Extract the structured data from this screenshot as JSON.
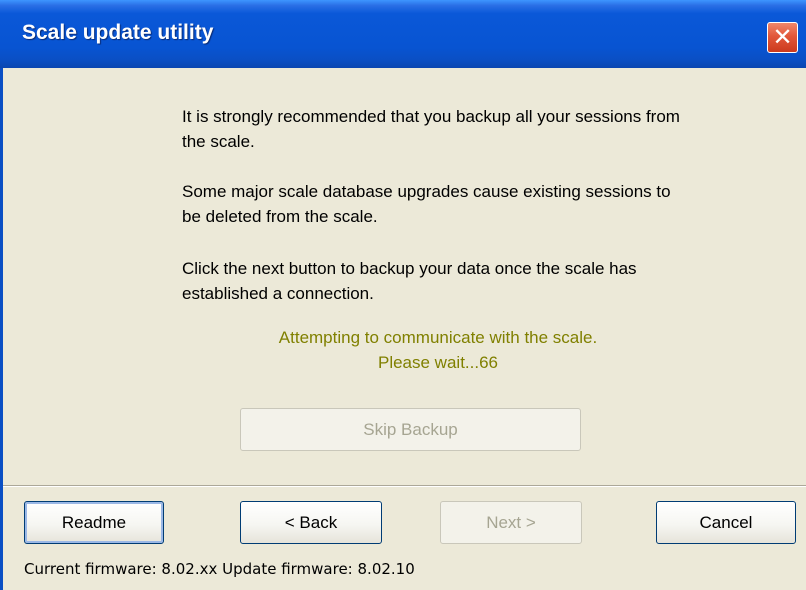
{
  "window": {
    "title": "Scale update utility",
    "close_symbol": "✕"
  },
  "content": {
    "para1": "It is strongly recommended that you backup all your sessions from the scale.",
    "para2": "Some major scale database upgrades cause existing sessions to be deleted from the scale.",
    "para3": "Click the next button to backup your data once the scale has established a connection.",
    "status_line1": "Attempting to communicate with the scale.",
    "status_line2": "Please wait...66",
    "status_color": "#808000",
    "skip_backup_label": "Skip Backup"
  },
  "buttons": {
    "readme": "Readme",
    "back": "< Back",
    "next": "Next >",
    "cancel": "Cancel"
  },
  "statusbar": {
    "text": "Current firmware: 8.02.xx Update firmware: 8.02.10"
  },
  "colors": {
    "titlebar": "#0854d2",
    "close_button": "#e2573a",
    "window_background": "#ece9d8"
  }
}
